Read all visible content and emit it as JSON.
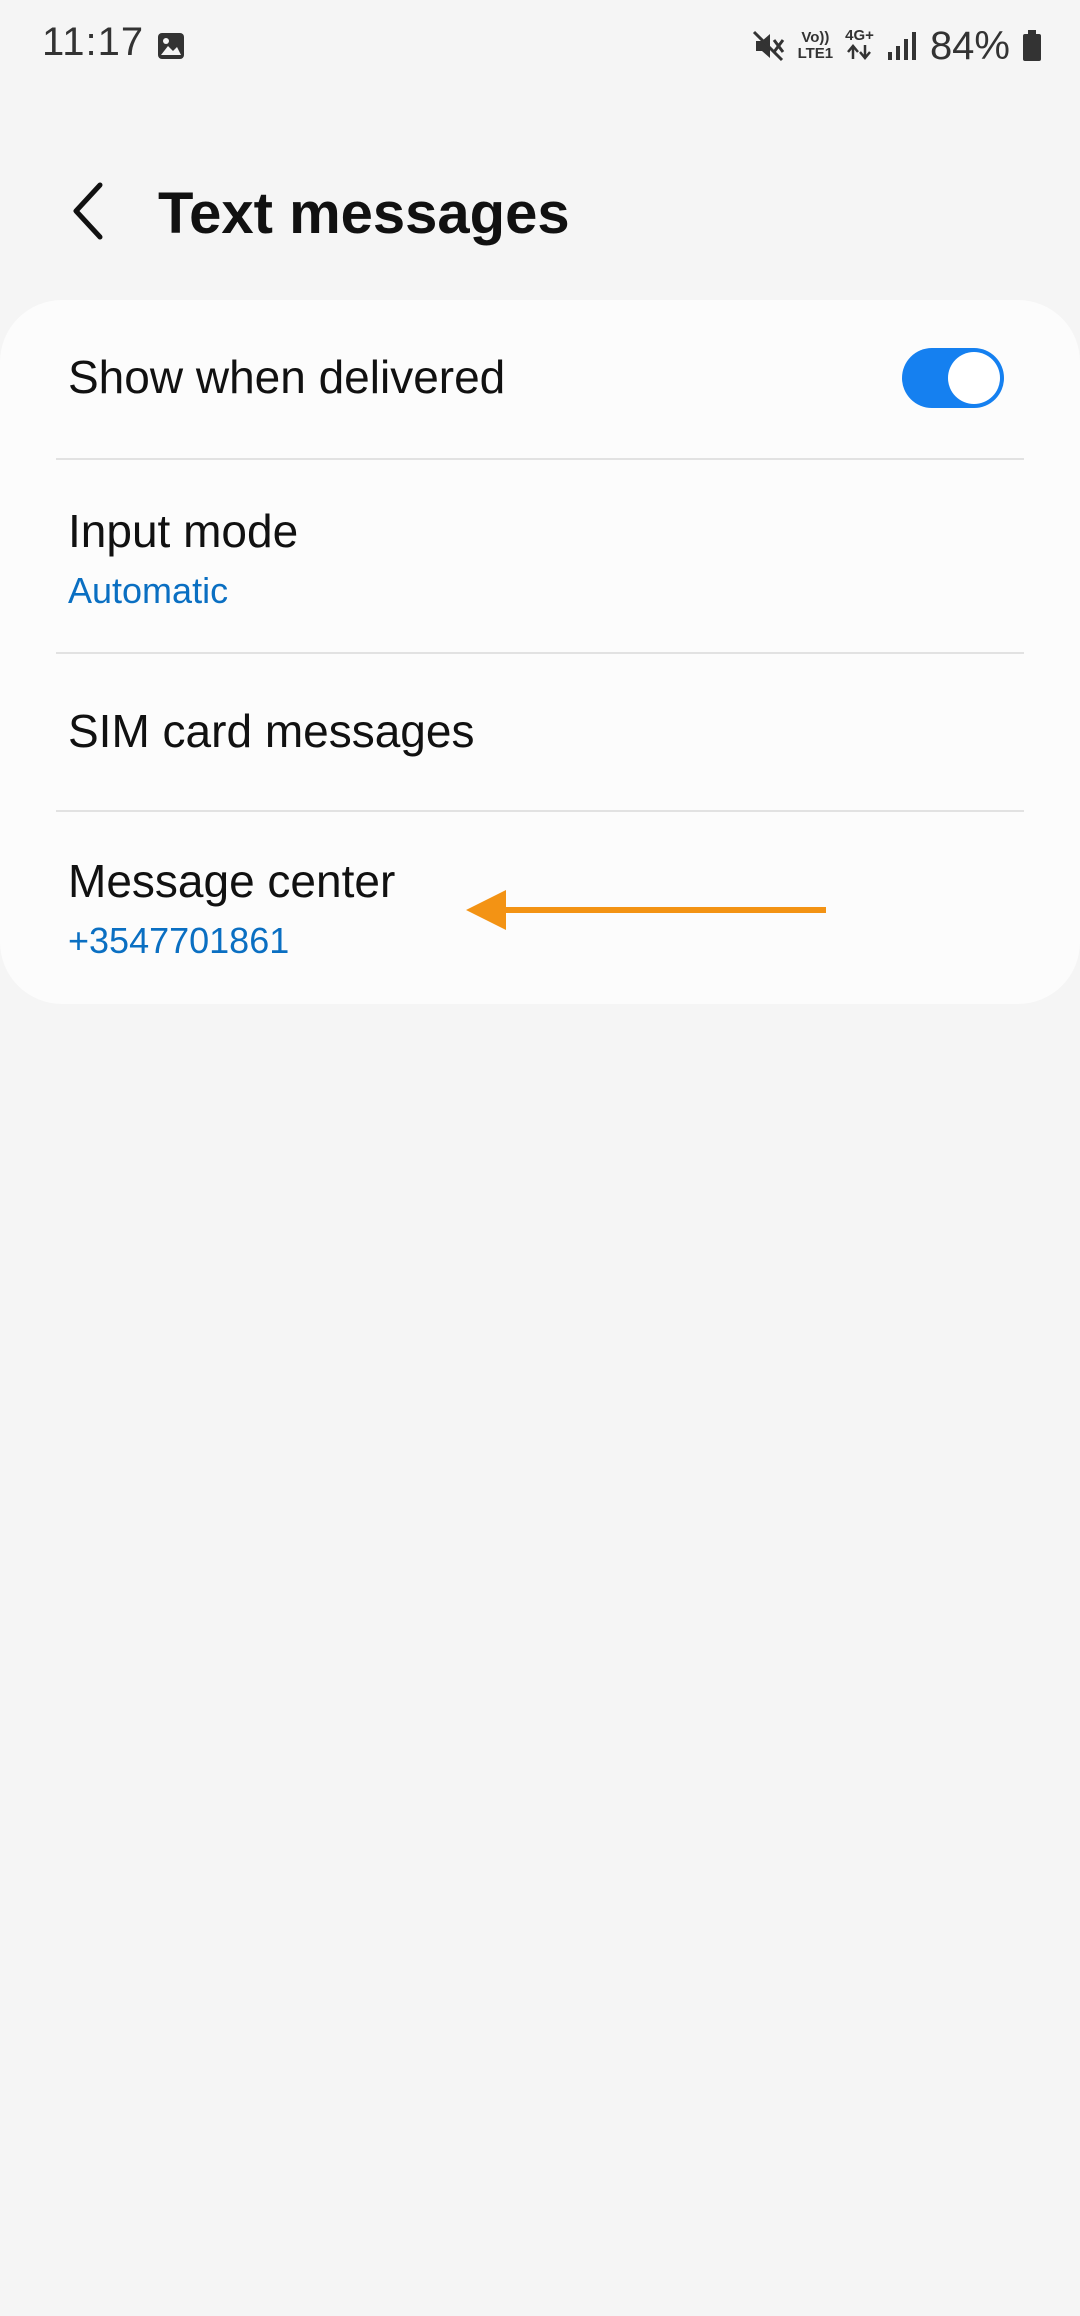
{
  "status_bar": {
    "time": "11:17",
    "volte_top": "Vo))",
    "volte_bottom": "LTE1",
    "network": "4G+",
    "battery": "84%",
    "icons": [
      "gallery-icon",
      "mute-icon",
      "volte-icon",
      "4g-icon",
      "signal-icon",
      "battery-icon"
    ]
  },
  "header": {
    "title": "Text messages",
    "back_icon": "chevron-left-icon"
  },
  "settings": {
    "show_when_delivered": {
      "title": "Show when delivered",
      "enabled": true
    },
    "input_mode": {
      "title": "Input mode",
      "value": "Automatic"
    },
    "sim_card_messages": {
      "title": "SIM card messages"
    },
    "message_center": {
      "title": "Message center",
      "value": "+3547701861"
    }
  },
  "annotation": {
    "icon": "arrow-left-icon",
    "color": "#f39314"
  },
  "colors": {
    "accent": "#1580f0",
    "link_text": "#0a6fc2",
    "background": "#f5f5f5",
    "card": "#fcfcfc"
  }
}
